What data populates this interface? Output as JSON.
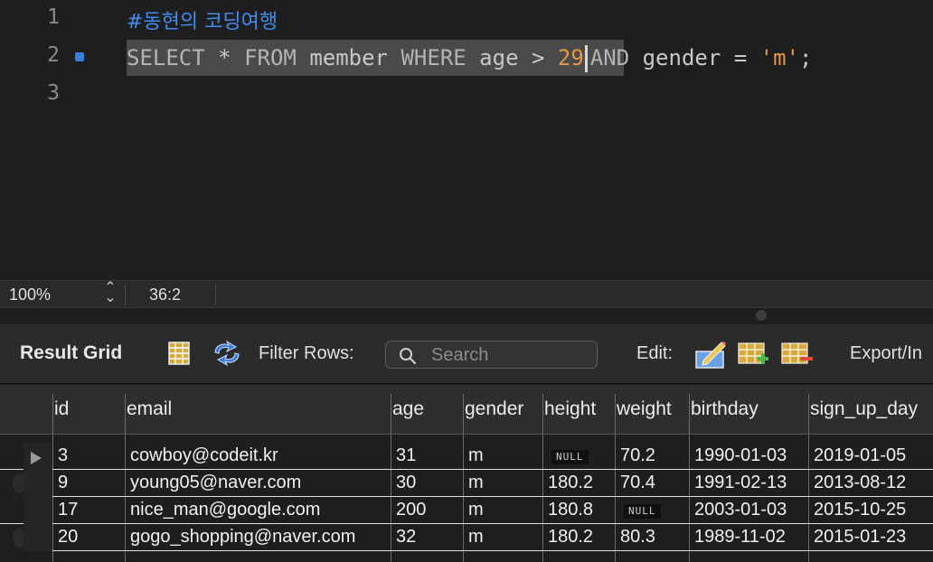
{
  "editor": {
    "line_numbers": [
      "1",
      "2",
      "3"
    ],
    "line1_comment": "#동현의 코딩여행",
    "line2": {
      "select": "SELECT",
      "star": "*",
      "from": "FROM",
      "table": "member",
      "where": "WHERE",
      "col_age": "age",
      "gt": ">",
      "num": "29",
      "and": "AND",
      "col_gender": "gender",
      "eq": "=",
      "str": "'m'",
      "semi": ";"
    }
  },
  "status": {
    "zoom": "100%",
    "cursor_position": "36:2"
  },
  "toolbar": {
    "result_grid_label": "Result Grid",
    "filter_rows_label": "Filter Rows:",
    "search_placeholder": "Search",
    "edit_label": "Edit:",
    "export_label": "Export/In"
  },
  "grid": {
    "columns": [
      "id",
      "email",
      "age",
      "gender",
      "height",
      "weight",
      "birthday",
      "sign_up_day"
    ],
    "null_label": "NULL",
    "rows": [
      {
        "id": "3",
        "email": "cowboy@codeit.kr",
        "age": "31",
        "gender": "m",
        "height": null,
        "weight": "70.2",
        "birthday": "1990-01-03",
        "sign_up_day": "2019-01-05"
      },
      {
        "id": "9",
        "email": "young05@naver.com",
        "age": "30",
        "gender": "m",
        "height": "180.2",
        "weight": "70.4",
        "birthday": "1991-02-13",
        "sign_up_day": "2013-08-12"
      },
      {
        "id": "17",
        "email": "nice_man@google.com",
        "age": "200",
        "gender": "m",
        "height": "180.8",
        "weight": null,
        "birthday": "2003-01-03",
        "sign_up_day": "2015-10-25"
      },
      {
        "id": "20",
        "email": "gogo_shopping@naver.com",
        "age": "32",
        "gender": "m",
        "height": "180.2",
        "weight": "80.3",
        "birthday": "1989-11-02",
        "sign_up_day": "2015-01-23"
      }
    ]
  },
  "colors": {
    "comment": "#3f8cf0",
    "number_string": "#e3974a",
    "keyword": "#b4b4b4",
    "background": "#1e1e1e"
  }
}
